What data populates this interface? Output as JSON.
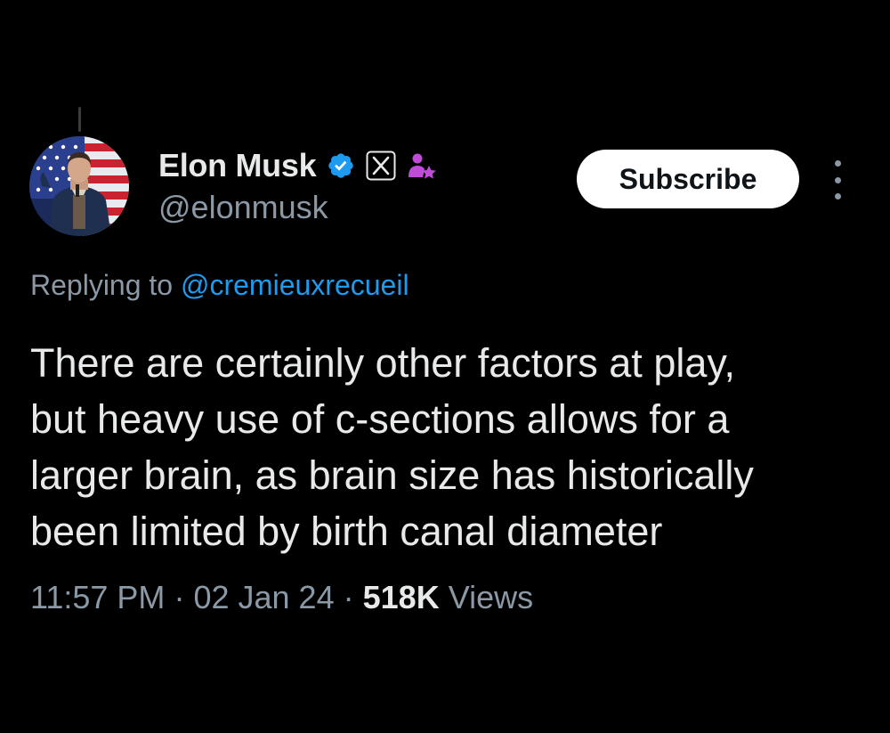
{
  "author": {
    "display_name": "Elon Musk",
    "handle": "@elonmusk",
    "avatar_icon": "profile-photo-avatar",
    "badges": [
      "verified-checkmark-icon",
      "x-logo-badge-icon",
      "user-star-icon"
    ]
  },
  "actions": {
    "subscribe_label": "Subscribe",
    "more_icon": "vertical-ellipsis-icon"
  },
  "reply": {
    "prefix": "Replying to ",
    "to_handle": "@cremieuxrecueil"
  },
  "tweet": {
    "lines": [
      "There are certainly other factors at play,",
      "but heavy use of c-sections allows for a",
      "larger brain, as brain size has historically",
      "been limited by birth canal diameter"
    ]
  },
  "meta": {
    "time": "11:57 PM",
    "separator": "·",
    "date": "02 Jan 24",
    "views_count": "518K",
    "views_label": "Views"
  },
  "colors": {
    "background": "#000000",
    "primary_text": "#e7e9ea",
    "secondary_text": "#8b98a5",
    "link": "#1d9bf0",
    "verified": "#1d9bf0",
    "affiliate_icon": "#c04bd9"
  }
}
